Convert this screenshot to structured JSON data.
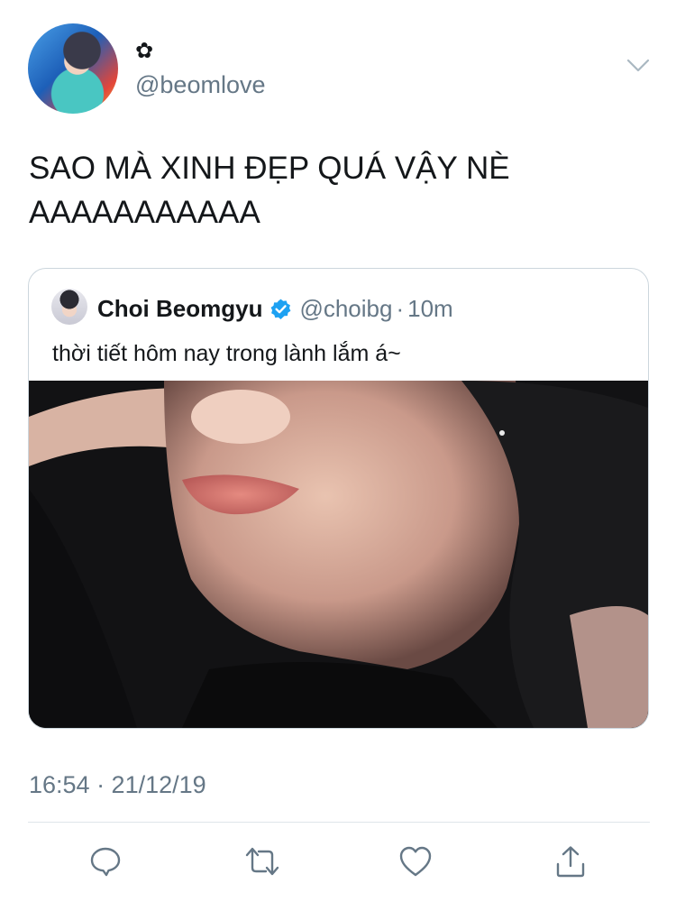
{
  "author": {
    "display_name": "✿",
    "handle": "@beomlove"
  },
  "tweet": {
    "text_line1": "SAO MÀ XINH ĐẸP QUÁ VẬY NÈ",
    "text_line2": "AAAAAAAAAAA",
    "timestamp": "16:54 · 21/12/19"
  },
  "quoted_tweet": {
    "name": "Choi Beomgyu",
    "handle": "@choibg",
    "separator": "·",
    "time": "10m",
    "text": "thời tiết hôm nay trong lành lắm á~",
    "verified": true
  },
  "colors": {
    "text": "#14171a",
    "secondary": "#657786",
    "border": "#ccd6dd",
    "verified_badge": "#1da1f2"
  },
  "icons": [
    "chevron-down-icon",
    "verified-icon",
    "reply-icon",
    "retweet-icon",
    "like-icon",
    "share-icon"
  ]
}
